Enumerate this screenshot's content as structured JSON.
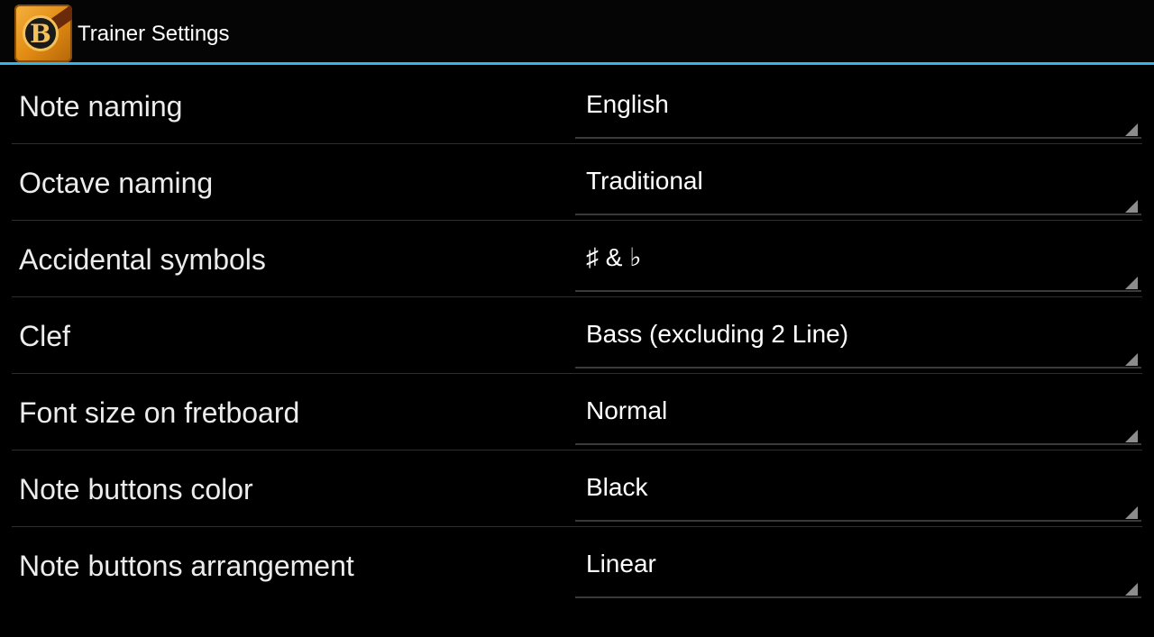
{
  "action_bar": {
    "title": "Trainer Settings",
    "icon": "app-logo-b-guitar",
    "icon_letter": "B",
    "accent_color": "#33b5e5"
  },
  "settings": [
    {
      "label": "Note naming",
      "value": "English"
    },
    {
      "label": "Octave naming",
      "value": "Traditional"
    },
    {
      "label": "Accidental symbols",
      "value": "♯ & ♭"
    },
    {
      "label": "Clef",
      "value": "Bass (excluding 2 Line)"
    },
    {
      "label": "Font size on fretboard",
      "value": "Normal"
    },
    {
      "label": "Note buttons color",
      "value": "Black"
    },
    {
      "label": "Note buttons arrangement",
      "value": "Linear"
    }
  ]
}
